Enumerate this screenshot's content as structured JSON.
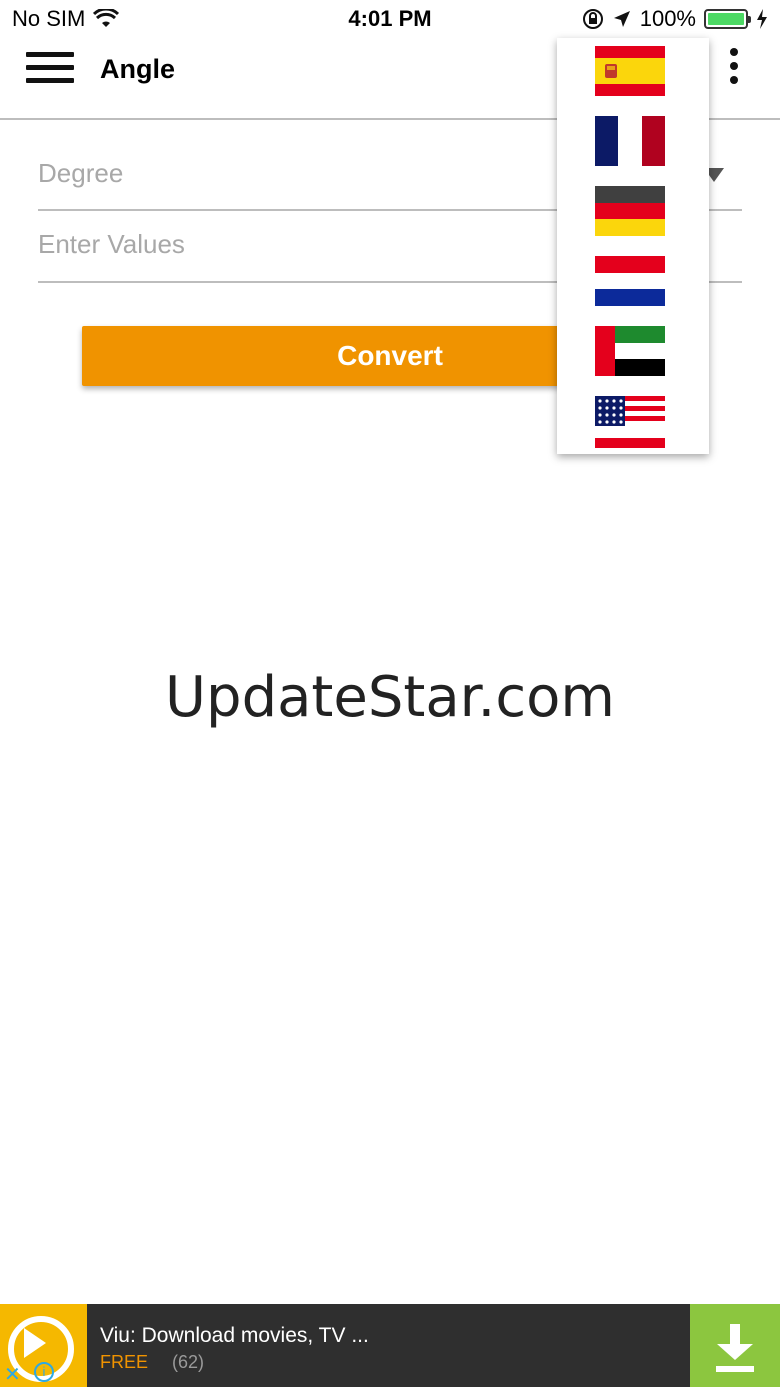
{
  "status_bar": {
    "carrier": "No SIM",
    "time": "4:01 PM",
    "battery": "100%"
  },
  "app_bar": {
    "title": "Angle"
  },
  "form": {
    "unit_placeholder": "Degree",
    "value_placeholder": "Enter Values",
    "convert_label": "Convert"
  },
  "watermark": "UpdateStar.com",
  "language_menu": {
    "flags": [
      "spain-flag-icon",
      "france-flag-icon",
      "germany-flag-icon",
      "netherlands-flag-icon",
      "uae-flag-icon",
      "usa-flag-icon"
    ]
  },
  "ad": {
    "title": "Viu: Download movies, TV ...",
    "price": "FREE",
    "rating_count": "(62)"
  },
  "colors": {
    "accent": "#f09300",
    "ad_download": "#8cc63f",
    "ad_logo": "#f5b800"
  }
}
